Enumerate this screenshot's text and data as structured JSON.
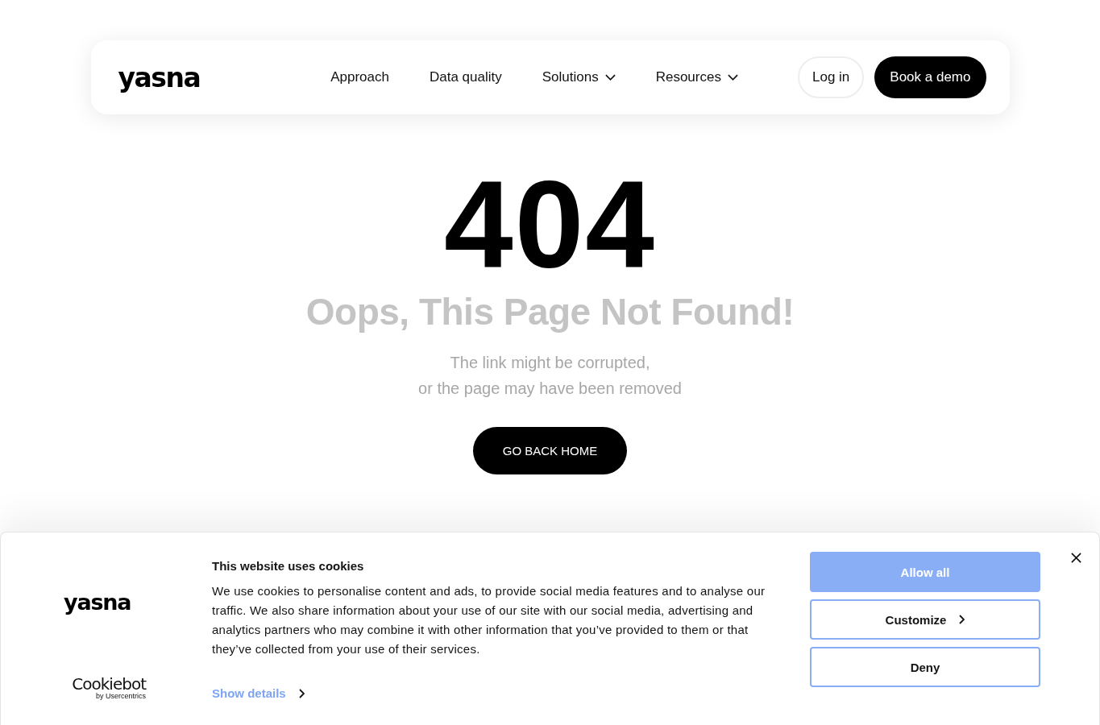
{
  "header": {
    "logo": "yasna",
    "nav": [
      {
        "label": "Approach",
        "dropdown": false
      },
      {
        "label": "Data quality",
        "dropdown": false
      },
      {
        "label": "Solutions",
        "dropdown": true
      },
      {
        "label": "Resources",
        "dropdown": true
      }
    ],
    "login": "Log in",
    "cta": "Book a demo"
  },
  "error": {
    "code": "404",
    "title": "Oops, This Page Not Found!",
    "message": "The link might be corrupted,\nor the page may have been removed",
    "button": "GO BACK HOME"
  },
  "cookie_banner": {
    "logo": "yasna",
    "provider": {
      "name": "Cookiebot",
      "byline": "by Usercentrics"
    },
    "title": "This website uses cookies",
    "text": "We use cookies to personalise content and ads, to provide social media features and to analyse our traffic. We also share information about your use of our site with our social media, advertising and analytics partners who may combine it with other information that you’ve provided to them or that they’ve collected from your use of their services.",
    "details_link": "Show details",
    "buttons": [
      {
        "label": "Allow all",
        "kind": "filled",
        "chevron": false
      },
      {
        "label": "Customize",
        "kind": "outlined",
        "chevron": true
      },
      {
        "label": "Deny",
        "kind": "outlined",
        "chevron": false
      }
    ]
  }
}
